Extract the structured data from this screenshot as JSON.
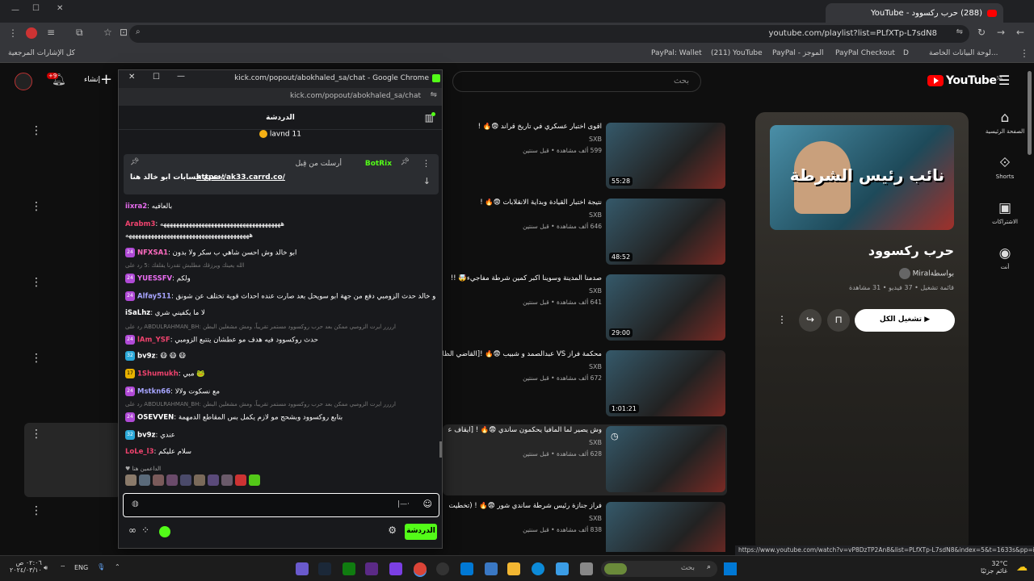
{
  "browser": {
    "tab_title": "(288) حرب ركسوود - YouTube",
    "url": "youtube.com/playlist?list=PLfXTp-L7sdN8",
    "bookmarks": [
      "لوحة البيانات الخاصة...",
      "D",
      "PayPal Checkout",
      "PayPal - الموجز",
      "(211) YouTube",
      "PayPal: Wallet"
    ],
    "all_bookmarks": "كل الإشارات المرجعية",
    "status_url": "https://www.youtube.com/watch?v=vP8DzTP2An8&list=PLfXTp-L7sdN8&index=5&t=1633s&pp=iAQB"
  },
  "youtube": {
    "logo": "YouTube",
    "country": "SA",
    "search_placeholder": "بحث",
    "create_label": "إنشاء",
    "notif_count": "+9",
    "nav": [
      {
        "icon": "home-icon",
        "label": "الصفحة الرئيسية"
      },
      {
        "icon": "shorts-icon",
        "label": "Shorts"
      },
      {
        "icon": "subscriptions-icon",
        "label": "الاشتراكات"
      },
      {
        "icon": "you-icon",
        "label": "أنت"
      }
    ],
    "playlist": {
      "title": "حرب ركسوود",
      "by": "بواسطةMiral",
      "meta": "قائمة تشغيل • 37 فيديو • 31 مشاهدة",
      "play_all": "تشغيل الكل",
      "thumb_text": "نائب رئيس الشرطة"
    },
    "videos": [
      {
        "title": "اقوى اختبار عسكري في تاريخ قراند 😨🔥 !",
        "channel": "SXB",
        "views": "599 ألف مشاهدة • قبل سنتين",
        "duration": "55:28"
      },
      {
        "title": "نتيجة اختبار القيادة وبداية الانقلابات 😨🔥 !",
        "channel": "SXB",
        "views": "646 ألف مشاهدة • قبل سنتين",
        "duration": "48:52"
      },
      {
        "title": "صدمنا المدينة وسوينا اكبر كمين شرطة مفاجيء🤯 !!",
        "channel": "SXB",
        "views": "641 ألف مشاهدة • قبل سنتين",
        "duration": "29:00"
      },
      {
        "title": "محكمة فراز VS عبدالصمد و شبيب 😨🔥 ![القاضي الظالم",
        "channel": "SXB",
        "views": "672 ألف مشاهدة • قبل سنتين",
        "duration": "1:01:21"
      },
      {
        "title": "وش يصير لما المافيا يحكمون ساندي 😨🔥 ! [ايقاف عبدالصمد",
        "channel": "SXB",
        "views": "628 ألف مشاهدة • قبل سنتين",
        "duration": ""
      },
      {
        "title": "فراز جنازة رئيس شرطة ساندي شور 😨🔥 ! (تخطيت بيديهم",
        "channel": "SXB",
        "views": "838 ألف مشاهدة • قبل سنتين",
        "duration": ""
      }
    ]
  },
  "popup": {
    "window_title": "kick.com/popout/abokhaled_sa/chat - Google Chrome",
    "url": "kick.com/popout/abokhaled_sa/chat",
    "chat_header": "الدردشة",
    "gift_line": "lavnd 11",
    "pinned_by": "أرسلت من قِبل",
    "pinned_user": "BotRix",
    "pinned_text": "جميع حسابات ابو خالد هنا:",
    "pinned_link": "https://ak33.carrd.co/",
    "messages": [
      {
        "user": "iixra2",
        "text": "بالعافيه",
        "color": "#e96cf0",
        "badge": ""
      },
      {
        "user": "Arabm3",
        "text": "ههههههههههههههههههههههههههههههههههههههه",
        "color": "#f0436e",
        "badge": ""
      },
      {
        "user": "",
        "text": "هههههههههههههههههههههههههههههههههههههههه",
        "color": "#fff",
        "badge": ""
      },
      {
        "user": "NFXSA1",
        "text": "ابو خالد وش احسن شاهي ب سكر ولا بدون",
        "color": "#ff6bc1",
        "badge": "24"
      },
      {
        "user": "YUESSFV",
        "text": "ولكم",
        "color": "#e96cf0",
        "badge": "24"
      },
      {
        "user": "Alfay511",
        "text": "ابو خالد حدث الزومبي دفع من جهة ابو سويحل بعد صارت عنده احداث قوية تختلف عن شونق",
        "color": "#a7a5ff",
        "badge": "24"
      },
      {
        "user": "iSaLhz",
        "text": "لا ما يكفيني شري",
        "color": "#fff",
        "badge": ""
      },
      {
        "user": "lAm_YSF",
        "text": "حدث روكسوود فيه هدف مو عطشان يتتبع الزومبي",
        "color": "#f0436e",
        "badge": "24"
      },
      {
        "user": "bv9z",
        "text": "",
        "color": "#fff",
        "badge": "32"
      },
      {
        "user": "1Shumukh",
        "text": "مبي",
        "color": "#f0436e",
        "badge": "17"
      },
      {
        "user": "Mstkn66",
        "text": "مع نسكوت ولالا",
        "color": "#a7a5ff",
        "badge": "24"
      },
      {
        "user": "OSEVVEN",
        "text": "بتابع روكسوود وبشحج مو لازم يكمل بس المقاطع الدمهمة",
        "color": "#fff",
        "badge": "24"
      },
      {
        "user": "bv9z",
        "text": "عندي",
        "color": "#fff",
        "badge": "32"
      },
      {
        "user": "LoLe_l3",
        "text": "سلام عليكم",
        "color": "#f0436e",
        "badge": ""
      }
    ],
    "reply_lines": [
      "الله يعينك ويرزقك مطلبش تقدرنا يقلقك :5 رد على",
      "رد على ABDULRAHMAN_BH: ارررر ايرت الزومبي ممكن بعد حرب روكسوود مستمر تقريباً، ومش مشغلين البطن",
      "رد على ABDULRAHMAN_BH: ارررر ايرت الزومبي ممكن بعد حرب روكسوود مستمر تقريباً، ومش مشغلين البطن"
    ],
    "supporters_label": "الداعمين هنا",
    "input_placeholder": "",
    "chat_button": "الدردشة"
  },
  "taskbar": {
    "time": "٠٢:٠٦ ص",
    "date": "٢٠٢٤/٠٣/١٠",
    "lang": "ENG",
    "weather": "32°C",
    "weather_label": "غائم جزئيًا",
    "search": "بحث"
  }
}
